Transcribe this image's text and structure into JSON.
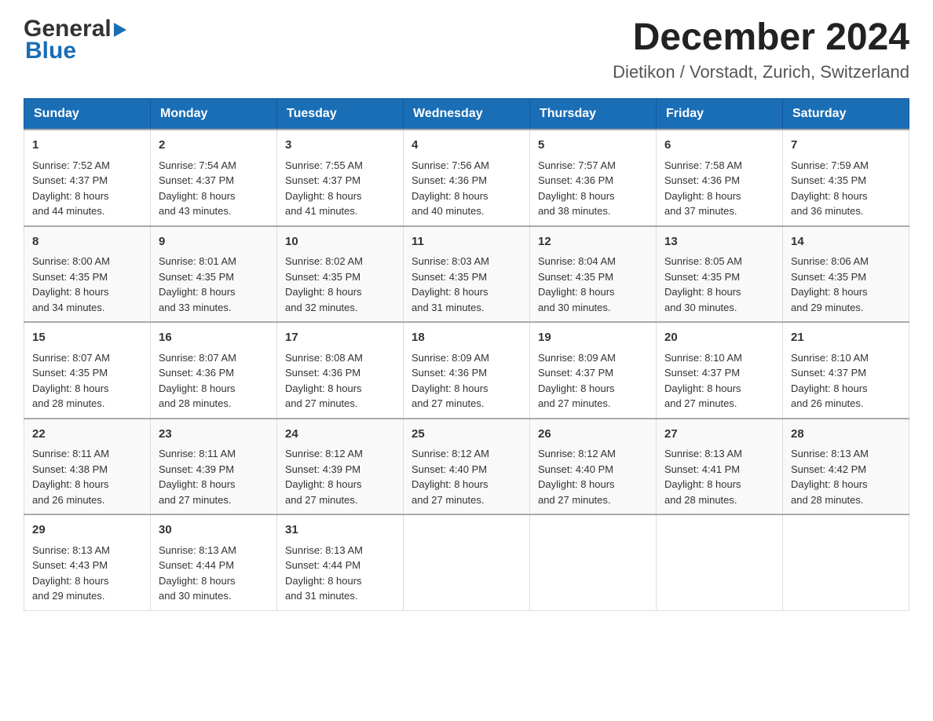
{
  "logo": {
    "general": "General",
    "blue": "Blue"
  },
  "header": {
    "title": "December 2024",
    "subtitle": "Dietikon / Vorstadt, Zurich, Switzerland"
  },
  "weekdays": [
    "Sunday",
    "Monday",
    "Tuesday",
    "Wednesday",
    "Thursday",
    "Friday",
    "Saturday"
  ],
  "weeks": [
    [
      {
        "day": "1",
        "sunrise": "7:52 AM",
        "sunset": "4:37 PM",
        "daylight": "8 hours and 44 minutes."
      },
      {
        "day": "2",
        "sunrise": "7:54 AM",
        "sunset": "4:37 PM",
        "daylight": "8 hours and 43 minutes."
      },
      {
        "day": "3",
        "sunrise": "7:55 AM",
        "sunset": "4:37 PM",
        "daylight": "8 hours and 41 minutes."
      },
      {
        "day": "4",
        "sunrise": "7:56 AM",
        "sunset": "4:36 PM",
        "daylight": "8 hours and 40 minutes."
      },
      {
        "day": "5",
        "sunrise": "7:57 AM",
        "sunset": "4:36 PM",
        "daylight": "8 hours and 38 minutes."
      },
      {
        "day": "6",
        "sunrise": "7:58 AM",
        "sunset": "4:36 PM",
        "daylight": "8 hours and 37 minutes."
      },
      {
        "day": "7",
        "sunrise": "7:59 AM",
        "sunset": "4:35 PM",
        "daylight": "8 hours and 36 minutes."
      }
    ],
    [
      {
        "day": "8",
        "sunrise": "8:00 AM",
        "sunset": "4:35 PM",
        "daylight": "8 hours and 34 minutes."
      },
      {
        "day": "9",
        "sunrise": "8:01 AM",
        "sunset": "4:35 PM",
        "daylight": "8 hours and 33 minutes."
      },
      {
        "day": "10",
        "sunrise": "8:02 AM",
        "sunset": "4:35 PM",
        "daylight": "8 hours and 32 minutes."
      },
      {
        "day": "11",
        "sunrise": "8:03 AM",
        "sunset": "4:35 PM",
        "daylight": "8 hours and 31 minutes."
      },
      {
        "day": "12",
        "sunrise": "8:04 AM",
        "sunset": "4:35 PM",
        "daylight": "8 hours and 30 minutes."
      },
      {
        "day": "13",
        "sunrise": "8:05 AM",
        "sunset": "4:35 PM",
        "daylight": "8 hours and 30 minutes."
      },
      {
        "day": "14",
        "sunrise": "8:06 AM",
        "sunset": "4:35 PM",
        "daylight": "8 hours and 29 minutes."
      }
    ],
    [
      {
        "day": "15",
        "sunrise": "8:07 AM",
        "sunset": "4:35 PM",
        "daylight": "8 hours and 28 minutes."
      },
      {
        "day": "16",
        "sunrise": "8:07 AM",
        "sunset": "4:36 PM",
        "daylight": "8 hours and 28 minutes."
      },
      {
        "day": "17",
        "sunrise": "8:08 AM",
        "sunset": "4:36 PM",
        "daylight": "8 hours and 27 minutes."
      },
      {
        "day": "18",
        "sunrise": "8:09 AM",
        "sunset": "4:36 PM",
        "daylight": "8 hours and 27 minutes."
      },
      {
        "day": "19",
        "sunrise": "8:09 AM",
        "sunset": "4:37 PM",
        "daylight": "8 hours and 27 minutes."
      },
      {
        "day": "20",
        "sunrise": "8:10 AM",
        "sunset": "4:37 PM",
        "daylight": "8 hours and 27 minutes."
      },
      {
        "day": "21",
        "sunrise": "8:10 AM",
        "sunset": "4:37 PM",
        "daylight": "8 hours and 26 minutes."
      }
    ],
    [
      {
        "day": "22",
        "sunrise": "8:11 AM",
        "sunset": "4:38 PM",
        "daylight": "8 hours and 26 minutes."
      },
      {
        "day": "23",
        "sunrise": "8:11 AM",
        "sunset": "4:39 PM",
        "daylight": "8 hours and 27 minutes."
      },
      {
        "day": "24",
        "sunrise": "8:12 AM",
        "sunset": "4:39 PM",
        "daylight": "8 hours and 27 minutes."
      },
      {
        "day": "25",
        "sunrise": "8:12 AM",
        "sunset": "4:40 PM",
        "daylight": "8 hours and 27 minutes."
      },
      {
        "day": "26",
        "sunrise": "8:12 AM",
        "sunset": "4:40 PM",
        "daylight": "8 hours and 27 minutes."
      },
      {
        "day": "27",
        "sunrise": "8:13 AM",
        "sunset": "4:41 PM",
        "daylight": "8 hours and 28 minutes."
      },
      {
        "day": "28",
        "sunrise": "8:13 AM",
        "sunset": "4:42 PM",
        "daylight": "8 hours and 28 minutes."
      }
    ],
    [
      {
        "day": "29",
        "sunrise": "8:13 AM",
        "sunset": "4:43 PM",
        "daylight": "8 hours and 29 minutes."
      },
      {
        "day": "30",
        "sunrise": "8:13 AM",
        "sunset": "4:44 PM",
        "daylight": "8 hours and 30 minutes."
      },
      {
        "day": "31",
        "sunrise": "8:13 AM",
        "sunset": "4:44 PM",
        "daylight": "8 hours and 31 minutes."
      },
      null,
      null,
      null,
      null
    ]
  ],
  "labels": {
    "sunrise": "Sunrise:",
    "sunset": "Sunset:",
    "daylight": "Daylight:"
  }
}
